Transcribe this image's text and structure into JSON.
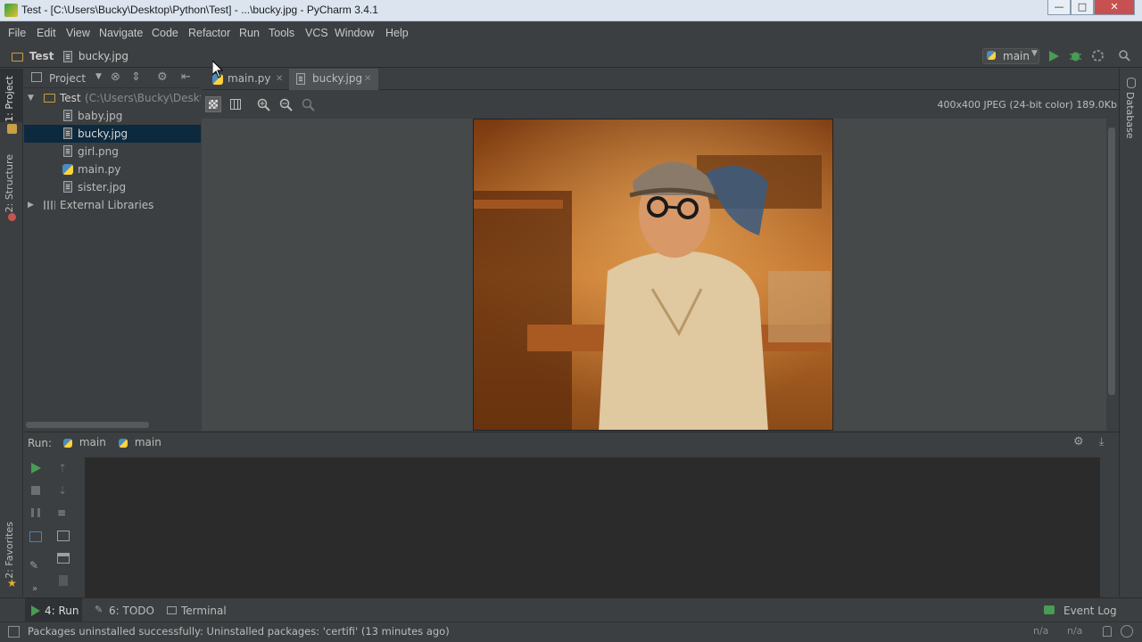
{
  "window": {
    "title": "Test - [C:\\Users\\Bucky\\Desktop\\Python\\Test] - ...\\bucky.jpg - PyCharm 3.4.1",
    "minimize": "—",
    "maximize": "□",
    "close": "✕"
  },
  "menu": [
    "File",
    "Edit",
    "View",
    "Navigate",
    "Code",
    "Refactor",
    "Run",
    "Tools",
    "VCS",
    "Window",
    "Help"
  ],
  "navbar": {
    "crumbs": [
      "Test",
      "bucky.jpg"
    ],
    "run_config": "main"
  },
  "left_tool_tabs": {
    "project": "1: Project",
    "structure": "2: Structure",
    "favorites": "2: Favorites"
  },
  "project_panel": {
    "view_label": "Project",
    "root": {
      "name": "Test",
      "path": "(C:\\Users\\Bucky\\Desktop"
    },
    "files": [
      "baby.jpg",
      "bucky.jpg",
      "girl.png",
      "main.py",
      "sister.jpg"
    ],
    "selected_file": "bucky.jpg",
    "external": "External Libraries"
  },
  "editor_tabs": [
    {
      "label": "main.py",
      "active": false
    },
    {
      "label": "bucky.jpg",
      "active": true
    }
  ],
  "image_info": "400x400 JPEG (24-bit color) 189.0Kb",
  "right_tool_tabs": {
    "database": "Database"
  },
  "run_panel": {
    "label": "Run:",
    "tabs": [
      "main",
      "main"
    ]
  },
  "bottom_tabs": [
    {
      "label": "4: Run"
    },
    {
      "label": "6: TODO"
    },
    {
      "label": "Terminal"
    }
  ],
  "event_log": "Event Log",
  "status": {
    "message": "Packages uninstalled successfully: Uninstalled packages: 'certifi' (13 minutes ago)",
    "pos1": "n/a",
    "pos2": "n/a"
  },
  "colors": {
    "background": "#3c3f41",
    "console": "#2b2b2b",
    "selection": "#0d293e",
    "run_green": "#499c54"
  }
}
